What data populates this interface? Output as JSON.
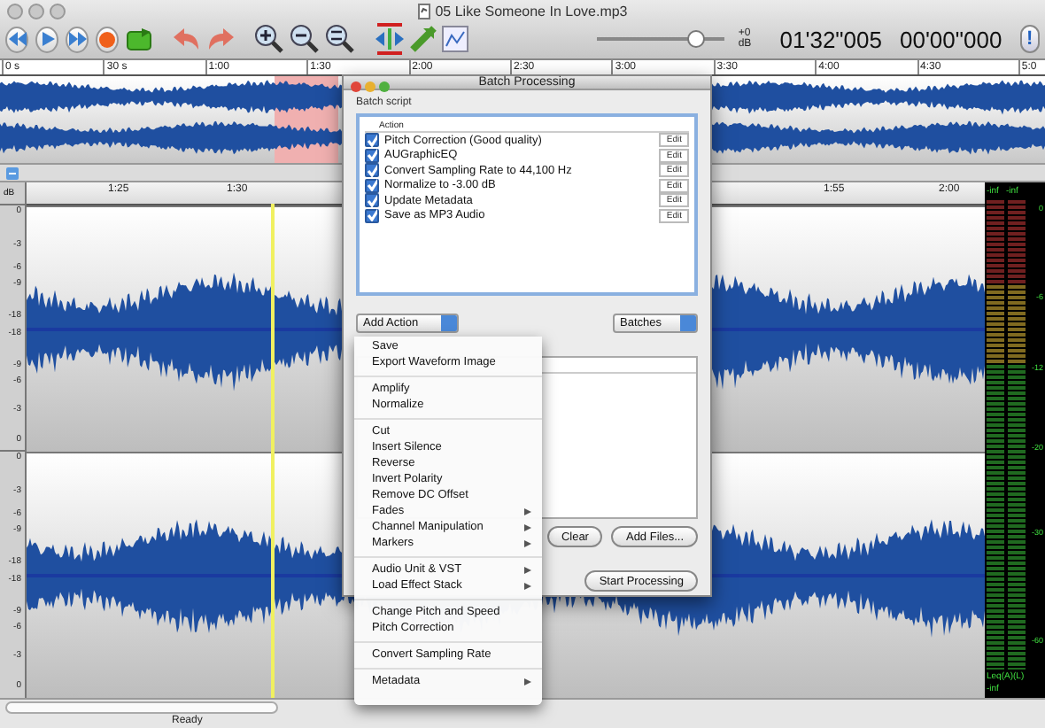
{
  "window": {
    "title": "05 Like Someone In Love.mp3"
  },
  "toolbar": {
    "volume": {
      "level": 0.76,
      "reading": "+0 dB"
    },
    "time_position": "01'32\"005",
    "time_selection": "00'00\"000",
    "info_label": "!"
  },
  "overview_ruler": [
    "0 s",
    "30 s",
    "1:00",
    "1:30",
    "2:00",
    "2:30",
    "3:00",
    "3:30",
    "4:00",
    "4:30",
    "5:0"
  ],
  "detail_ruler": [
    "1:25",
    "1:30",
    "1:55",
    "2:00"
  ],
  "db_scale": {
    "unit": "dB",
    "channel_1": [
      "0",
      "-3",
      "-6",
      "-9",
      "-18",
      "-18",
      "-9",
      "-6",
      "-3",
      "0"
    ],
    "channel_2": [
      "0",
      "-3",
      "-6",
      "-9",
      "-18",
      "-18",
      "-9",
      "-6",
      "-3",
      "0"
    ]
  },
  "meter": {
    "peaks": [
      "-inf",
      "-inf"
    ],
    "scale": [
      "0",
      "-6",
      "-12",
      "-20",
      "-30",
      "-60"
    ],
    "mode": "Leq(A)(L)",
    "reading": "-inf"
  },
  "status_bar": {
    "text": "Ready"
  },
  "dialog": {
    "title": "Batch Processing",
    "section": "Batch script",
    "column": "Action",
    "actions": [
      {
        "label": "Pitch Correction (Good quality)",
        "checked": true,
        "edit": "Edit"
      },
      {
        "label": "AUGraphicEQ",
        "checked": true,
        "edit": "Edit"
      },
      {
        "label": "Convert Sampling Rate to 44,100 Hz",
        "checked": true,
        "edit": "Edit"
      },
      {
        "label": "Normalize to -3.00 dB",
        "checked": true,
        "edit": "Edit"
      },
      {
        "label": "Update Metadata",
        "checked": true,
        "edit": "Edit"
      },
      {
        "label": "Save as MP3 Audio",
        "checked": true,
        "edit": "Edit"
      }
    ],
    "add_action": "Add Action",
    "batches": "Batches",
    "clear": "Clear",
    "add_files": "Add Files...",
    "start": "Start Processing"
  },
  "menu": {
    "groups": [
      [
        {
          "label": "Save",
          "submenu": false
        },
        {
          "label": "Export Waveform Image",
          "submenu": false
        }
      ],
      [
        {
          "label": "Amplify",
          "submenu": false
        },
        {
          "label": "Normalize",
          "submenu": false
        }
      ],
      [
        {
          "label": "Cut",
          "submenu": false
        },
        {
          "label": "Insert Silence",
          "submenu": false
        },
        {
          "label": "Reverse",
          "submenu": false
        },
        {
          "label": "Invert Polarity",
          "submenu": false
        },
        {
          "label": "Remove DC Offset",
          "submenu": false
        },
        {
          "label": "Fades",
          "submenu": true
        },
        {
          "label": "Channel Manipulation",
          "submenu": true
        },
        {
          "label": "Markers",
          "submenu": true
        }
      ],
      [
        {
          "label": "Audio Unit & VST",
          "submenu": true
        },
        {
          "label": "Load Effect Stack",
          "submenu": true
        }
      ],
      [
        {
          "label": "Change Pitch and Speed",
          "submenu": false
        },
        {
          "label": "Pitch Correction",
          "submenu": false
        }
      ],
      [
        {
          "label": "Convert Sampling Rate",
          "submenu": false
        }
      ],
      [
        {
          "label": "Metadata",
          "submenu": true
        }
      ]
    ]
  }
}
